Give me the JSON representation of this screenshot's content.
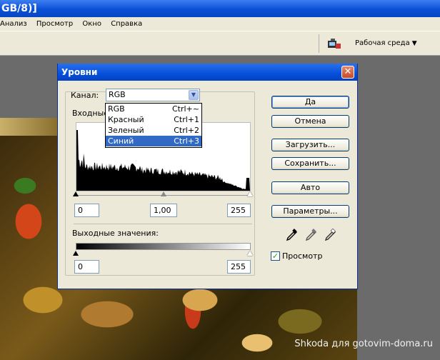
{
  "window": {
    "title": "GB/8)]"
  },
  "menu": [
    "Анализ",
    "Просмотр",
    "Окно",
    "Справка"
  ],
  "toolbar": {
    "workspace_label": "Рабочая среда",
    "workspace_icon": "chevron-down-icon"
  },
  "dialog": {
    "title": "Уровни",
    "channel_label": "Канал:",
    "channel_value": "RGB",
    "channel_options": [
      {
        "name": "RGB",
        "shortcut": "Ctrl+~"
      },
      {
        "name": "Красный",
        "shortcut": "Ctrl+1"
      },
      {
        "name": "Зеленый",
        "shortcut": "Ctrl+2"
      },
      {
        "name": "Синий",
        "shortcut": "Ctrl+3"
      }
    ],
    "highlighted_option": "Синий",
    "input_label": "Входные",
    "input_black": "0",
    "input_gamma": "1,00",
    "input_white": "255",
    "output_label": "Выходные значения:",
    "output_black": "0",
    "output_white": "255",
    "buttons": {
      "ok": "Да",
      "cancel": "Отмена",
      "load": "Загрузить...",
      "save": "Сохранить...",
      "auto": "Авто",
      "options": "Параметры..."
    },
    "preview_label": "Просмотр",
    "preview_checked": true
  },
  "credit": "Shkoda для gotovim-doma.ru",
  "colors": {
    "titlebar": "#0a50d6",
    "dialog_bg": "#ece9d8",
    "selection": "#316ac5"
  }
}
